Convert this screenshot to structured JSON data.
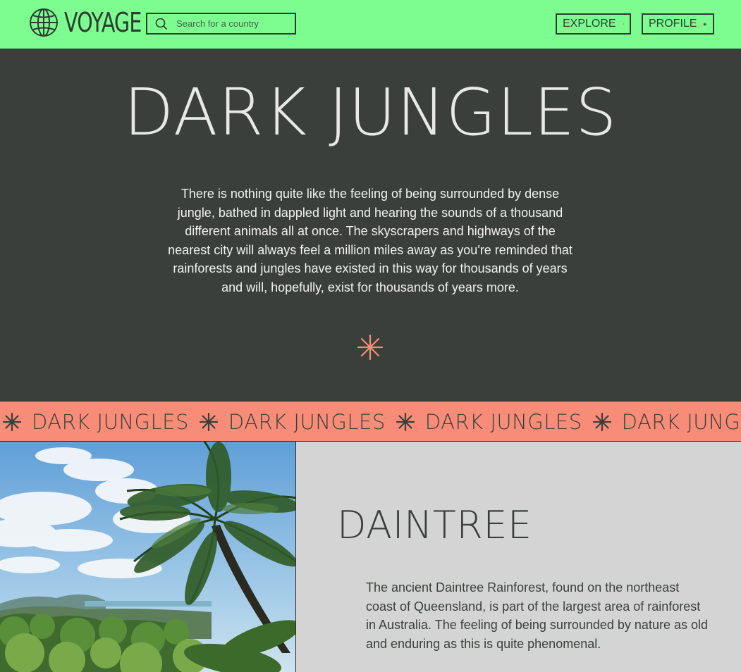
{
  "header": {
    "logo_text": "VOYAGE",
    "logo_icon": "globe-icon",
    "search": {
      "placeholder": "Search for a country",
      "value": "",
      "icon": "search-icon"
    },
    "nav": [
      {
        "label": "EXPLORE",
        "icon": "arrow-up-right-icon"
      },
      {
        "label": "PROFILE",
        "icon": "asterisk-icon"
      }
    ]
  },
  "hero": {
    "title": "DARK JUNGLES",
    "body": "There is nothing quite like the feeling of being surrounded by dense jungle, bathed in dappled light and hearing the sounds of a thousand different animals all at once. The skyscrapers and highways of the nearest city will always feel a million miles away as you're reminded that rainforests and jungles have existed in this way for thousands of years and will, hopefully, exist for thousands of years more.",
    "divider_icon": "asterisk-icon"
  },
  "marquee": {
    "items": [
      "DARK JUNGLES",
      "DARK JUNGLES",
      "DARK JUNGLES",
      "DARK JUNGLES"
    ],
    "separator_icon": "asterisk-icon"
  },
  "feature": {
    "title": "DAINTREE",
    "body": "The ancient Daintree Rainforest, found on the northeast coast of Queensland, is part of the largest area of rainforest in Australia. The feeling of being surrounded by nature as old and enduring as this is quite phenomenal."
  },
  "colors": {
    "header_bg": "#7dfd8f",
    "hero_bg": "#3a3f3b",
    "accent": "#f78d78",
    "panel_bg": "#d4d4d4",
    "text_dark": "#3a3f3b",
    "text_light": "#f2f2f2"
  }
}
